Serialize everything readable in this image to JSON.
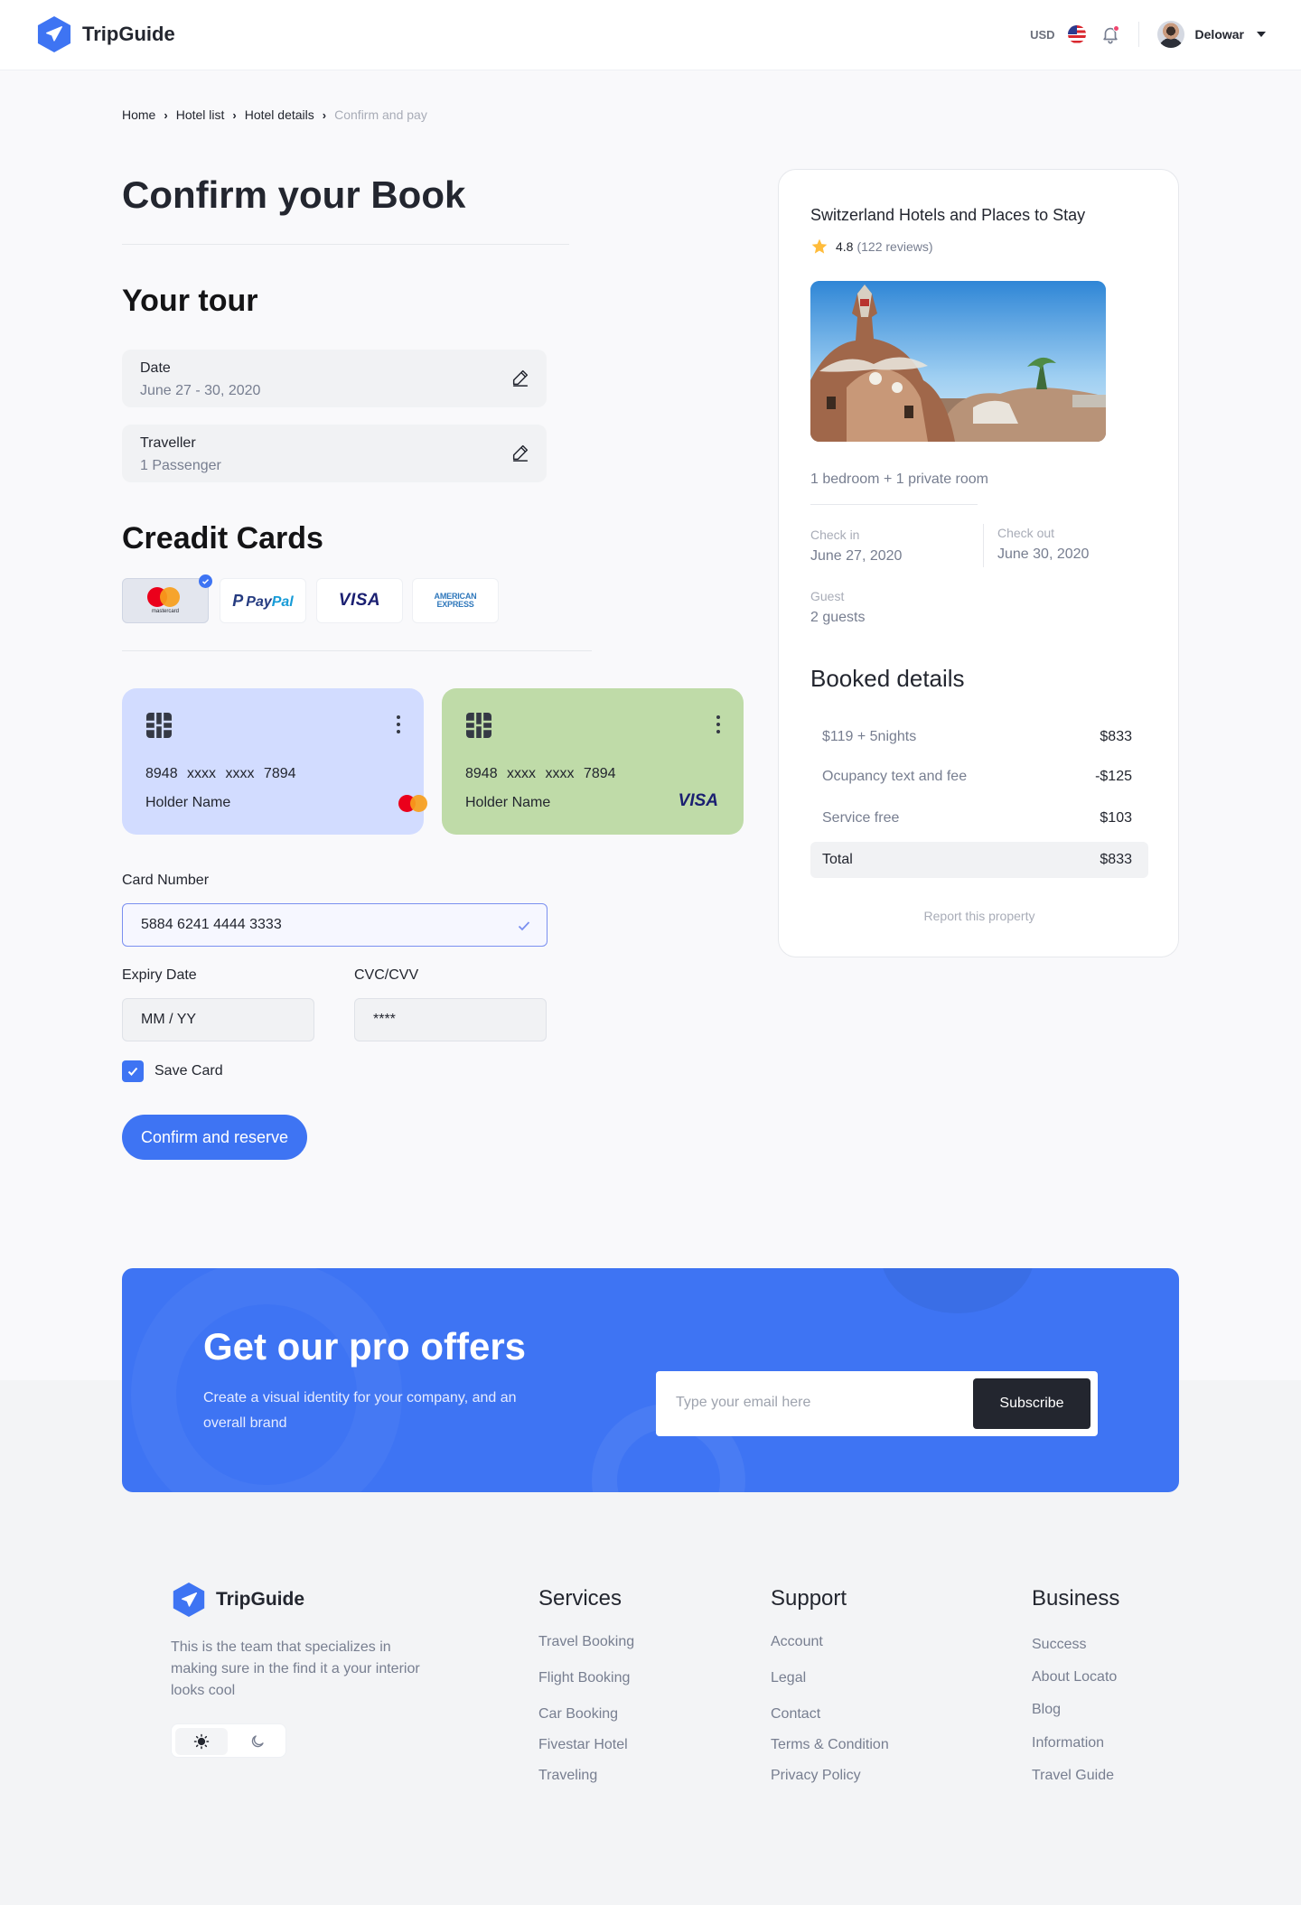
{
  "app": {
    "name": "TripGuide"
  },
  "header": {
    "currency": "USD",
    "username": "Delowar",
    "flag": "us-flag-icon"
  },
  "breadcrumb": [
    "Home",
    "Hotel list",
    "Hotel details",
    "Confirm and pay"
  ],
  "page": {
    "title": "Confirm your Book"
  },
  "tour": {
    "title": "Your tour",
    "date_label": "Date",
    "date_value": "June 27 - 30, 2020",
    "traveller_label": "Traveller",
    "traveller_value": "1 Passenger"
  },
  "cards": {
    "title": "Creadit Cards",
    "payment_options": [
      {
        "name": "mastercard",
        "label": "mastercard",
        "selected": true
      },
      {
        "name": "paypal",
        "label_a": "Pay",
        "label_b": "Pal",
        "selected": false
      },
      {
        "name": "visa",
        "label": "VISA",
        "selected": false
      },
      {
        "name": "amex",
        "label_line1": "AMERICAN",
        "label_line2": "EXPRESS",
        "selected": false
      }
    ],
    "saved": [
      {
        "number": "8948 xxxx xxxx 7894",
        "holder": "Holder Name",
        "brand": "mastercard",
        "color": "#d2dcff"
      },
      {
        "number": "8948 xxxx xxxx 7894",
        "holder": "Holder Name",
        "brand": "VISA",
        "color": "#bfdba8"
      }
    ]
  },
  "form": {
    "card_number_label": "Card Number",
    "card_number_value": "5884 6241 4444 3333",
    "expiry_label": "Expiry Date",
    "expiry_placeholder": "MM / YY",
    "cvc_label": "CVC/CVV",
    "cvc_value": "****",
    "save_card_label": "Save Card",
    "save_card_checked": true,
    "submit_label": "Confirm and reserve"
  },
  "summary": {
    "title": "Switzerland Hotels and Places to Stay",
    "rating": "4.8",
    "reviews": "(122 reviews)",
    "rooms": "1 bedroom  +  1 private room",
    "check_in_label": "Check in",
    "check_in_value": "June 27, 2020",
    "check_out_label": "Check out",
    "check_out_value": "June 30, 2020",
    "guest_label": "Guest",
    "guest_value": "2 guests",
    "booked_title": "Booked details",
    "rows": [
      {
        "label": "$119  +  5nights",
        "value": "$833"
      },
      {
        "label": "Ocupancy text and fee",
        "value": "-$125"
      },
      {
        "label": "Service free",
        "value": "$103"
      },
      {
        "label": "Total",
        "value": "$833"
      }
    ],
    "report": "Report this property"
  },
  "newsletter": {
    "title": "Get our pro offers",
    "description": "Create a visual identity for your company, and an overall brand",
    "email_placeholder": "Type your email here",
    "subscribe_label": "Subscribe"
  },
  "footer": {
    "brand": "TripGuide",
    "description": "This is the team that specializes in making sure in the find it a your interior looks cool",
    "services": {
      "title": "Services",
      "links": [
        "Travel Booking",
        "Flight Booking",
        "Car Booking",
        "Fivestar Hotel",
        "Traveling"
      ]
    },
    "support": {
      "title": "Support",
      "links": [
        "Account",
        "Legal",
        "Contact",
        "Terms & Condition",
        "Privacy Policy"
      ]
    },
    "business": {
      "title": "Business",
      "links": [
        "Success",
        "About Locato",
        "Blog",
        "Information",
        "Travel Guide"
      ]
    }
  },
  "colors": {
    "primary": "#3e74f3",
    "dark": "#23262f",
    "muted": "#777e90"
  }
}
